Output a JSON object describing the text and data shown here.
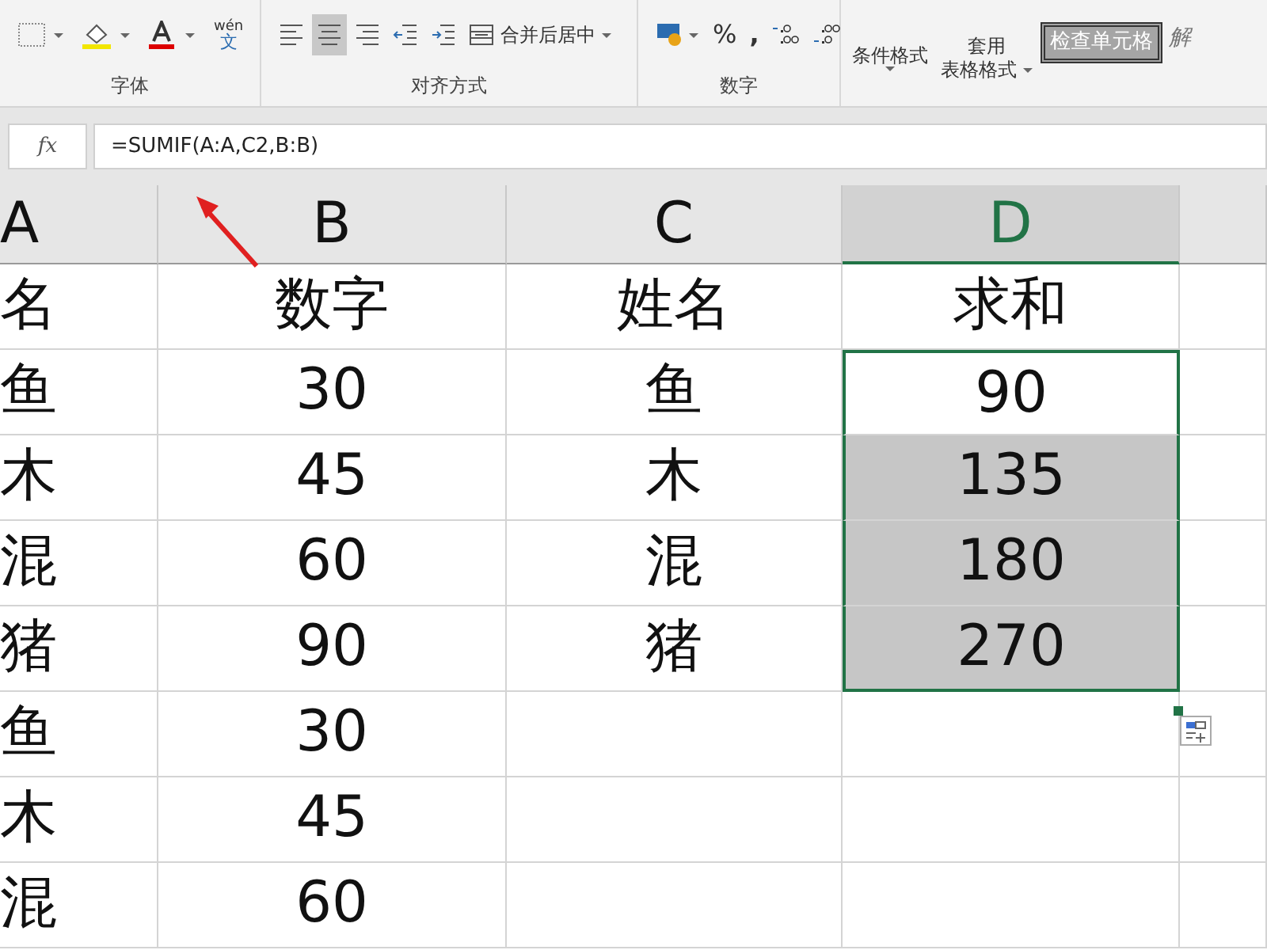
{
  "ribbon": {
    "groups": [
      {
        "kind": "font",
        "label": "字体",
        "wen_label": "wén",
        "wen_char": "文"
      },
      {
        "kind": "align",
        "label": "对齐方式",
        "merge_label": "合并后居中",
        "align_selected": [
          false,
          true,
          false
        ]
      },
      {
        "kind": "number",
        "label": "数字",
        "percent": "%",
        "comma": ","
      },
      {
        "kind": "styles",
        "cond_format": "条件格式",
        "table_format_1": "套用",
        "table_format_2": "表格格式",
        "style_cell": "检查单元格",
        "style_cut": "解"
      }
    ]
  },
  "formula_bar": {
    "fx": "fx",
    "formula": "=SUMIF(A:A,C2,B:B)"
  },
  "sheet": {
    "columns": [
      {
        "header": "A",
        "selected": false
      },
      {
        "header": "B",
        "selected": false
      },
      {
        "header": "C",
        "selected": false
      },
      {
        "header": "D",
        "selected": true
      },
      {
        "selected": false
      }
    ],
    "rows": [
      [
        {
          "text": "名",
          "selected": false,
          "active": false
        },
        {
          "text": "数字",
          "selected": false,
          "active": false
        },
        {
          "text": "姓名",
          "selected": false,
          "active": false
        },
        {
          "text": "求和",
          "selected": false,
          "active": false
        },
        {
          "text": "",
          "selected": false,
          "active": false
        }
      ],
      [
        {
          "text": "鱼",
          "selected": false,
          "active": false
        },
        {
          "text": "30",
          "selected": false,
          "active": false
        },
        {
          "text": "鱼",
          "selected": false,
          "active": false
        },
        {
          "text": "90",
          "selected": true,
          "active": true
        },
        {
          "text": "",
          "selected": false,
          "active": false
        }
      ],
      [
        {
          "text": "木",
          "selected": false,
          "active": false
        },
        {
          "text": "45",
          "selected": false,
          "active": false
        },
        {
          "text": "木",
          "selected": false,
          "active": false
        },
        {
          "text": "135",
          "selected": true,
          "active": false
        },
        {
          "text": "",
          "selected": false,
          "active": false
        }
      ],
      [
        {
          "text": "混",
          "selected": false,
          "active": false
        },
        {
          "text": "60",
          "selected": false,
          "active": false
        },
        {
          "text": "混",
          "selected": false,
          "active": false
        },
        {
          "text": "180",
          "selected": true,
          "active": false
        },
        {
          "text": "",
          "selected": false,
          "active": false
        }
      ],
      [
        {
          "text": "猪",
          "selected": false,
          "active": false
        },
        {
          "text": "90",
          "selected": false,
          "active": false
        },
        {
          "text": "猪",
          "selected": false,
          "active": false
        },
        {
          "text": "270",
          "selected": true,
          "active": false
        },
        {
          "text": "",
          "selected": false,
          "active": false
        }
      ],
      [
        {
          "text": "鱼",
          "selected": false,
          "active": false
        },
        {
          "text": "30",
          "selected": false,
          "active": false
        },
        {
          "text": "",
          "selected": false,
          "active": false
        },
        {
          "text": "",
          "selected": false,
          "active": false
        },
        {
          "text": "",
          "selected": false,
          "active": false
        }
      ],
      [
        {
          "text": "木",
          "selected": false,
          "active": false
        },
        {
          "text": "45",
          "selected": false,
          "active": false
        },
        {
          "text": "",
          "selected": false,
          "active": false
        },
        {
          "text": "",
          "selected": false,
          "active": false
        },
        {
          "text": "",
          "selected": false,
          "active": false
        }
      ],
      [
        {
          "text": "混",
          "selected": false,
          "active": false
        },
        {
          "text": "60",
          "selected": false,
          "active": false
        },
        {
          "text": "",
          "selected": false,
          "active": false
        },
        {
          "text": "",
          "selected": false,
          "active": false
        },
        {
          "text": "",
          "selected": false,
          "active": false
        }
      ]
    ]
  }
}
